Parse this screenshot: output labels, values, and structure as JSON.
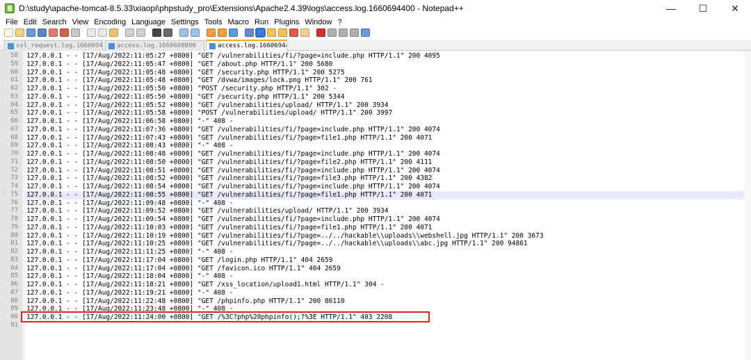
{
  "window": {
    "title": "D:\\study\\apache-tomcat-8.5.33\\xiaopi\\phpstudy_pro\\Extensions\\Apache2.4.39\\logs\\access.log.1660694400 - Notepad++",
    "minimize": "—",
    "maximize": "☐",
    "close": "✕"
  },
  "menu": [
    "File",
    "Edit",
    "Search",
    "View",
    "Encoding",
    "Language",
    "Settings",
    "Tools",
    "Macro",
    "Run",
    "Plugins",
    "Window",
    "?"
  ],
  "tabs": [
    {
      "label": "ssl_request.log.1660694400",
      "active": false
    },
    {
      "label": "access.log.1660608000",
      "active": false
    },
    {
      "label": "access.log.1660694400",
      "active": true
    }
  ],
  "tab_close": "✕",
  "editor": {
    "first_line": 58,
    "current_line": 75,
    "highlighted_line": 90,
    "lines": [
      "127.0.0.1 - - [17/Aug/2022:11:05:27 +0800] \"GET /vulnerabilities/fi/?page=include.php HTTP/1.1\" 200 4095",
      "127.0.0.1 - - [17/Aug/2022:11:05:47 +0800] \"GET /about.php HTTP/1.1\" 200 5680",
      "127.0.0.1 - - [17/Aug/2022:11:05:48 +0800] \"GET /security.php HTTP/1.1\" 200 5275",
      "127.0.0.1 - - [17/Aug/2022:11:05:48 +0800] \"GET /dvwa/images/lock.png HTTP/1.1\" 200 761",
      "127.0.0.1 - - [17/Aug/2022:11:05:50 +0800] \"POST /security.php HTTP/1.1\" 302 -",
      "127.0.0.1 - - [17/Aug/2022:11:05:50 +0800] \"GET /security.php HTTP/1.1\" 200 5344",
      "127.0.0.1 - - [17/Aug/2022:11:05:52 +0800] \"GET /vulnerabilities/upload/ HTTP/1.1\" 200 3934",
      "127.0.0.1 - - [17/Aug/2022:11:05:58 +0800] \"POST /vulnerabilities/upload/ HTTP/1.1\" 200 3997",
      "127.0.0.1 - - [17/Aug/2022:11:06:58 +0800] \"-\" 408 -",
      "127.0.0.1 - - [17/Aug/2022:11:07:36 +0800] \"GET /vulnerabilities/fi/?page=include.php HTTP/1.1\" 200 4074",
      "127.0.0.1 - - [17/Aug/2022:11:07:43 +0800] \"GET /vulnerabilities/fi/?page=file1.php HTTP/1.1\" 200 4071",
      "127.0.0.1 - - [17/Aug/2022:11:08:43 +0800] \"-\" 408 -",
      "127.0.0.1 - - [17/Aug/2022:11:08:48 +0800] \"GET /vulnerabilities/fi/?page=include.php HTTP/1.1\" 200 4074",
      "127.0.0.1 - - [17/Aug/2022:11:08:50 +0800] \"GET /vulnerabilities/fi/?page=file2.php HTTP/1.1\" 200 4111",
      "127.0.0.1 - - [17/Aug/2022:11:08:51 +0800] \"GET /vulnerabilities/fi/?page=include.php HTTP/1.1\" 200 4074",
      "127.0.0.1 - - [17/Aug/2022:11:08:52 +0800] \"GET /vulnerabilities/fi/?page=file3.php HTTP/1.1\" 200 4382",
      "127.0.0.1 - - [17/Aug/2022:11:08:54 +0800] \"GET /vulnerabilities/fi/?page=include.php HTTP/1.1\" 200 4074",
      "127.0.0.1 - - [17/Aug/2022:11:08:55 +0800] \"GET /vulnerabilities/fi/?page=file1.php HTTP/1.1\" 200 4071",
      "127.0.0.1 - - [17/Aug/2022:11:09:48 +0800] \"-\" 408 -",
      "127.0.0.1 - - [17/Aug/2022:11:09:52 +0800] \"GET /vulnerabilities/upload/ HTTP/1.1\" 200 3934",
      "127.0.0.1 - - [17/Aug/2022:11:09:54 +0800] \"GET /vulnerabilities/fi/?page=include.php HTTP/1.1\" 200 4074",
      "127.0.0.1 - - [17/Aug/2022:11:10:03 +0800] \"GET /vulnerabilities/fi/?page=file1.php HTTP/1.1\" 200 4071",
      "127.0.0.1 - - [17/Aug/2022:11:10:19 +0800] \"GET /vulnerabilities/fi/?page=../../hackable\\\\uploads\\\\webshell.jpg HTTP/1.1\" 200 3673",
      "127.0.0.1 - - [17/Aug/2022:11:10:25 +0800] \"GET /vulnerabilities/fi/?page=../../hackable\\\\uploads\\\\abc.jpg HTTP/1.1\" 200 94861",
      "127.0.0.1 - - [17/Aug/2022:11:11:25 +0800] \"-\" 408 -",
      "127.0.0.1 - - [17/Aug/2022:11:17:04 +0800] \"GET /login.php HTTP/1.1\" 404 2659",
      "127.0.0.1 - - [17/Aug/2022:11:17:04 +0800] \"GET /favicon.ico HTTP/1.1\" 404 2659",
      "127.0.0.1 - - [17/Aug/2022:11:18:04 +0800] \"-\" 408 -",
      "127.0.0.1 - - [17/Aug/2022:11:18:21 +0800] \"GET /xss_location/upload1.html HTTP/1.1\" 304 -",
      "127.0.0.1 - - [17/Aug/2022:11:19:21 +0800] \"-\" 408 -",
      "127.0.0.1 - - [17/Aug/2022:11:22:48 +0800] \"GET /phpinfo.php HTTP/1.1\" 200 86110",
      "127.0.0.1 - - [17/Aug/2022:11:23:48 +0800] \"-\" 408 -",
      "127.0.0.1 - - [17/Aug/2022:11:24:00 +0800] \"GET /%3C?php%20phpinfo();?%3E HTTP/1.1\" 403 2208",
      ""
    ]
  }
}
